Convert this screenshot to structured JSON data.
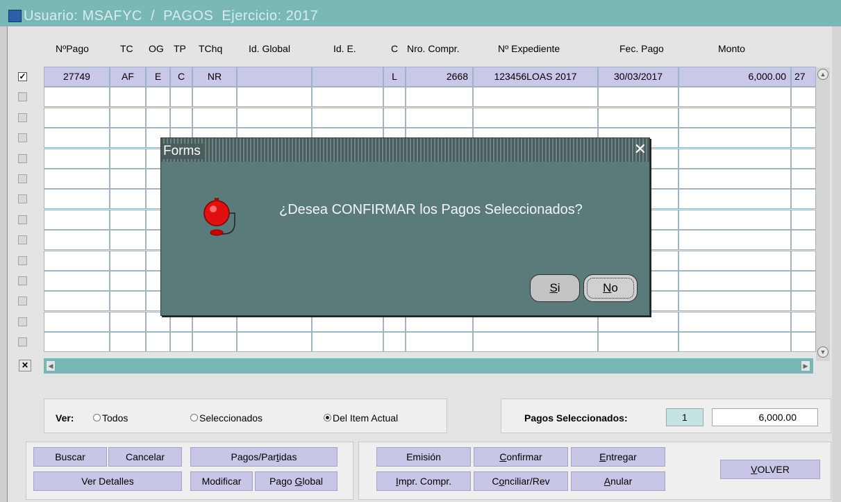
{
  "window": {
    "title": "Usuario: MSAFYC  /  PAGOS  Ejercicio: 2017"
  },
  "grid": {
    "headers": {
      "npago": "NºPago",
      "tc": "TC",
      "og": "OG",
      "tp": "TP",
      "tchq": "TChq",
      "idglobal": "Id. Global",
      "ide": "Id. E.",
      "c": "C",
      "nrocompr": "Nro. Compr.",
      "expediente": "Nº Expediente",
      "fecpago": "Fec. Pago",
      "monto": "Monto"
    },
    "row1": {
      "checked": "✓",
      "npago": "27749",
      "tc": "AF",
      "og": "E",
      "tp": "C",
      "tchq": "NR",
      "idglobal": "",
      "ide": "",
      "c": "L",
      "nrocompr": "2668",
      "expediente": "123456LOAS 2017",
      "fecpago": "30/03/2017",
      "monto": "6,000.00",
      "extra": "27"
    }
  },
  "dialog": {
    "title": "Forms",
    "message": "¿Desea CONFIRMAR los Pagos Seleccionados?",
    "yes_key": "S",
    "yes_rest": "i",
    "no_key": "N",
    "no_rest": "o",
    "icon": "alarm-bell-icon"
  },
  "ver": {
    "label": "Ver:",
    "options": [
      "Todos",
      "Seleccionados",
      "Del Item Actual"
    ],
    "selected": "Del Item Actual"
  },
  "pagos": {
    "label": "Pagos Seleccionados:",
    "count": "1",
    "total": "6,000.00"
  },
  "buttons": {
    "buscar": "Buscar",
    "cancelar": "Cancelar",
    "pagos_partidas_a": "Pagos/Par",
    "pagos_partidas_key": "t",
    "pagos_partidas_b": "idas",
    "ver_detalles": "Ver Detalles",
    "modificar": "Modificar",
    "pago_global_a": "Pago ",
    "pago_global_key": "G",
    "pago_global_b": "lobal",
    "emision": "Emisión",
    "confirmar_key": "C",
    "confirmar_rest": "onfirmar",
    "entregar_key": "E",
    "entregar_rest": "ntregar",
    "impr_key": "I",
    "impr_rest": "mpr. Compr.",
    "conciliar_a": "C",
    "conciliar_key": "o",
    "conciliar_b": "nciliar/Rev",
    "anular_key": "A",
    "anular_rest": "nular",
    "volver_key": "V",
    "volver_rest": "OLVER"
  },
  "colors": {
    "titlebar": "#7ab8b8",
    "dialog": "#5b7a7a",
    "button": "#c7c6e6",
    "selected_row": "#c9c8e8"
  }
}
